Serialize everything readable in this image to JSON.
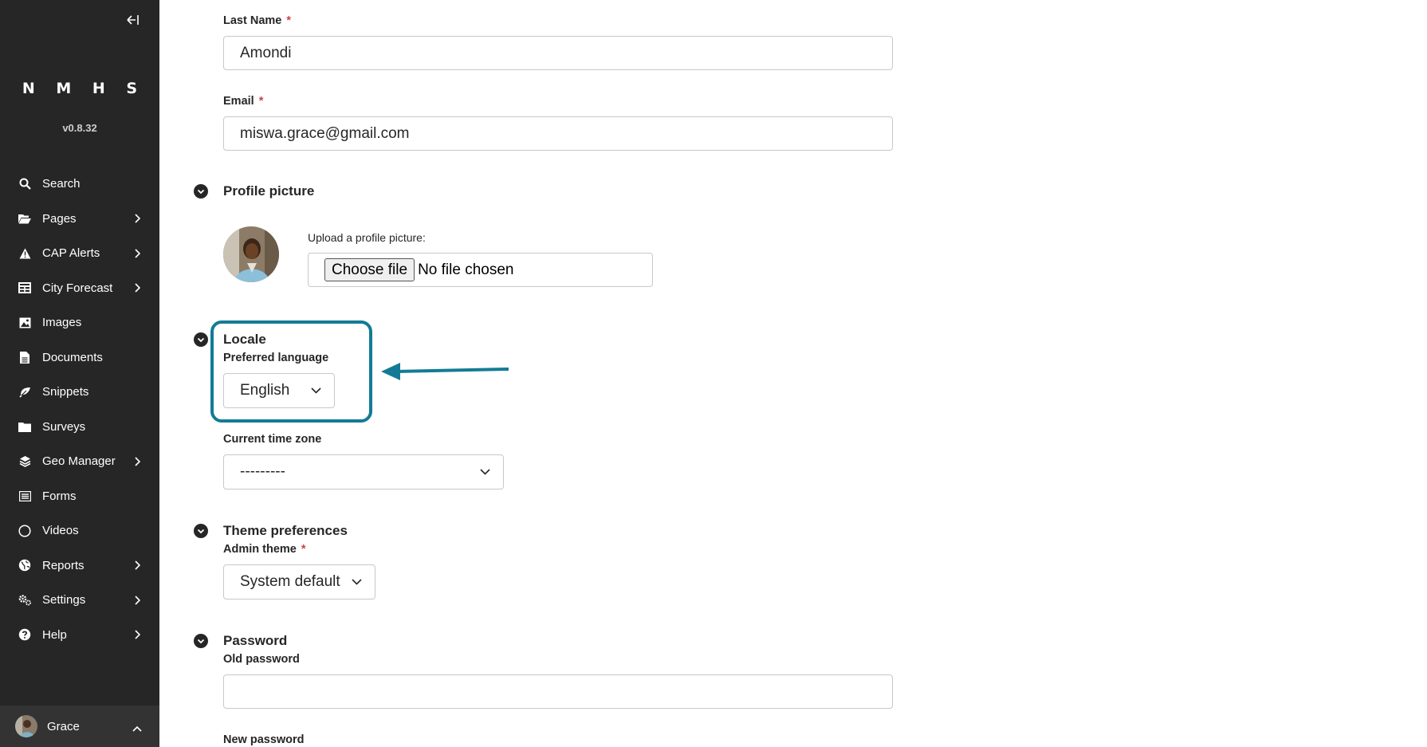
{
  "sidebar": {
    "logo": "N M H S",
    "version": "v0.8.32",
    "items": [
      {
        "label": "Search",
        "icon": "search-icon",
        "has_submenu": false
      },
      {
        "label": "Pages",
        "icon": "folder-open-icon",
        "has_submenu": true
      },
      {
        "label": "CAP Alerts",
        "icon": "warning-icon",
        "has_submenu": true
      },
      {
        "label": "City Forecast",
        "icon": "table-icon",
        "has_submenu": true
      },
      {
        "label": "Images",
        "icon": "image-icon",
        "has_submenu": false
      },
      {
        "label": "Documents",
        "icon": "document-icon",
        "has_submenu": false
      },
      {
        "label": "Snippets",
        "icon": "leaf-icon",
        "has_submenu": false
      },
      {
        "label": "Surveys",
        "icon": "folder-icon",
        "has_submenu": false
      },
      {
        "label": "Geo Manager",
        "icon": "layers-icon",
        "has_submenu": true
      },
      {
        "label": "Forms",
        "icon": "list-icon",
        "has_submenu": false
      },
      {
        "label": "Videos",
        "icon": "circle-icon",
        "has_submenu": false
      },
      {
        "label": "Reports",
        "icon": "globe-icon",
        "has_submenu": true
      },
      {
        "label": "Settings",
        "icon": "cogs-icon",
        "has_submenu": true
      },
      {
        "label": "Help",
        "icon": "help-icon",
        "has_submenu": true
      }
    ],
    "account": {
      "name": "Grace"
    }
  },
  "form": {
    "last_name": {
      "label": "Last Name",
      "required_mark": "*",
      "value": "Amondi"
    },
    "email": {
      "label": "Email",
      "required_mark": "*",
      "value": "miswa.grace@gmail.com"
    },
    "profile_picture": {
      "title": "Profile picture",
      "upload_label": "Upload a profile picture:",
      "choose_button": "Choose file",
      "file_status": "No file chosen"
    },
    "locale": {
      "title": "Locale",
      "language_label": "Preferred language",
      "language_value": "English",
      "timezone_label": "Current time zone",
      "timezone_value": "---------"
    },
    "theme": {
      "title": "Theme preferences",
      "admin_theme_label": "Admin theme",
      "required_mark": "*",
      "admin_theme_value": "System default"
    },
    "password": {
      "title": "Password",
      "old_label": "Old password",
      "old_value": "",
      "new_label": "New password"
    }
  },
  "colors": {
    "sidebar_bg": "#262626",
    "highlight": "#137b95",
    "required": "#cd4444"
  }
}
